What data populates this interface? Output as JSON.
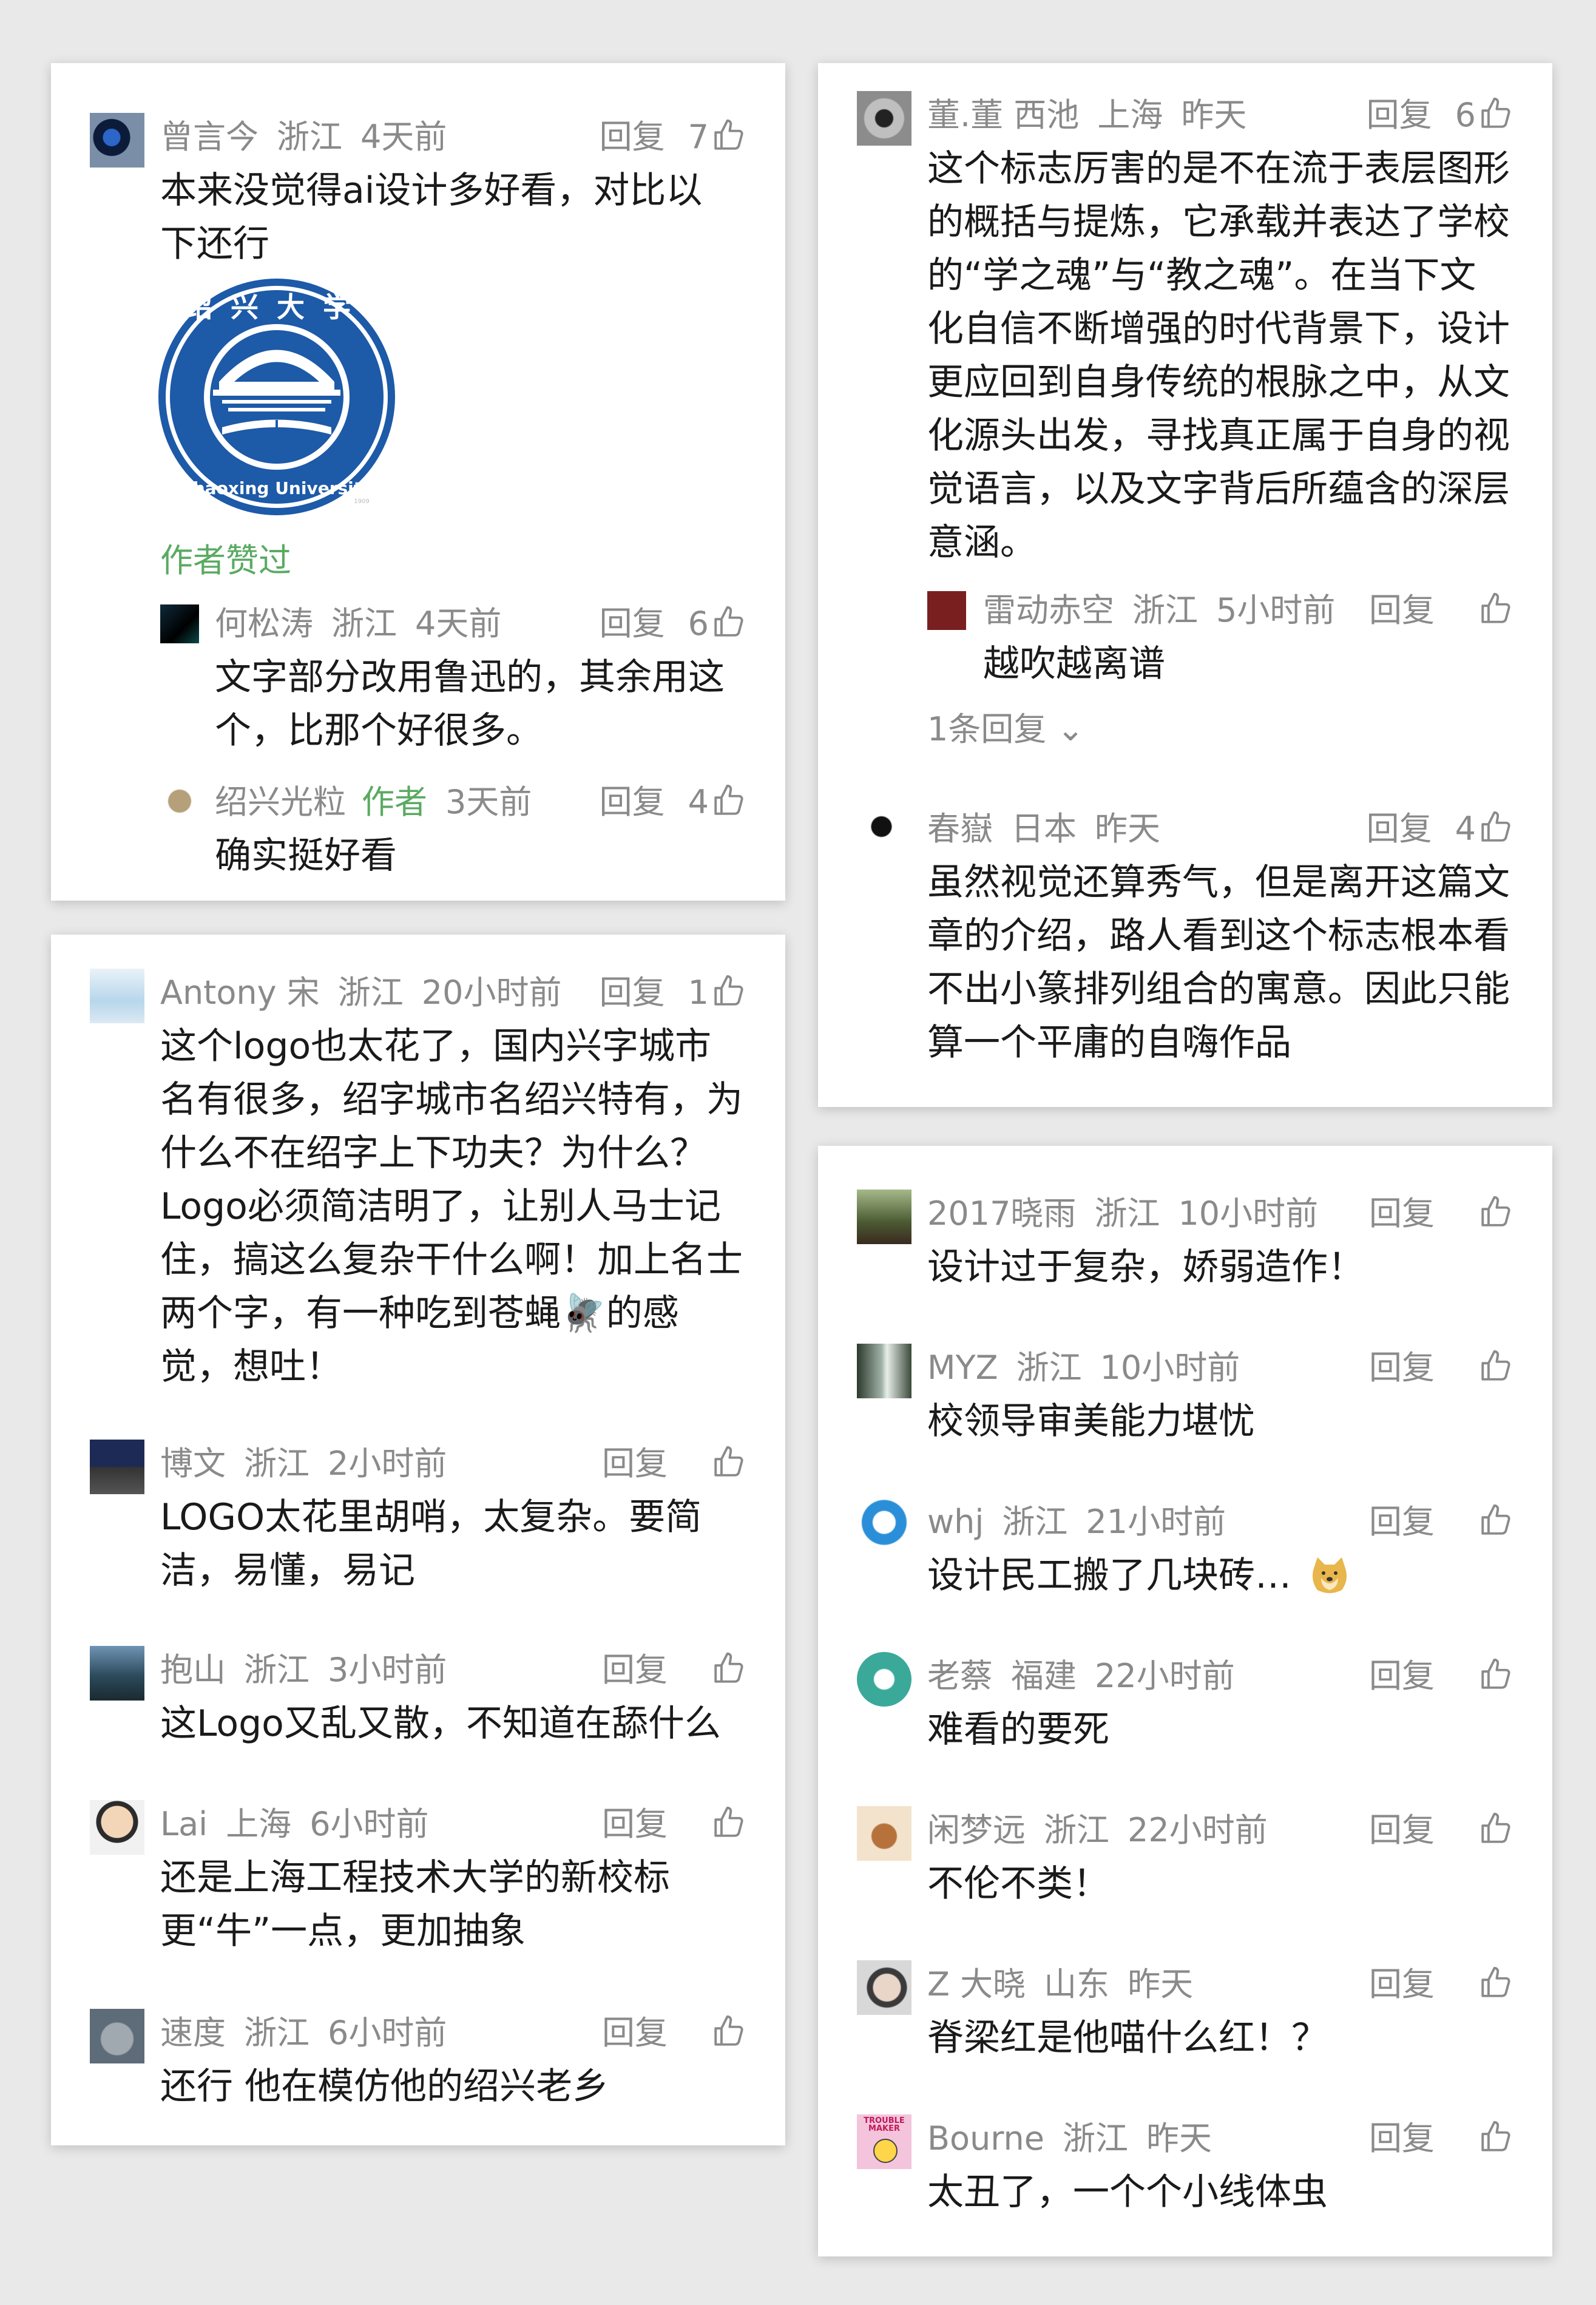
{
  "c1": {
    "main": {
      "name": "曾言今",
      "loc": "浙江",
      "time": "4天前",
      "reply": "回复",
      "likes": "7",
      "text": "本来没觉得ai设计多好看，对比以下还行"
    },
    "logo": {
      "top_text": "绍兴大学",
      "bottom_text": "Shaoxing University",
      "mark": "1909"
    },
    "liked": "作者赞过",
    "r1": {
      "name": "何松涛",
      "loc": "浙江",
      "time": "4天前",
      "reply": "回复",
      "likes": "6",
      "text": "文字部分改用鲁迅的，其余用这个，比那个好很多。"
    },
    "r2": {
      "name": "绍兴光粒",
      "author": "作者",
      "time": "3天前",
      "reply": "回复",
      "likes": "4",
      "text": "确实挺好看"
    }
  },
  "c2": {
    "a": {
      "name": "Antony 宋",
      "loc": "浙江",
      "time": "20小时前",
      "reply": "回复",
      "likes": "1",
      "text": "这个logo也太花了，国内兴字城市名有很多，绍字城市名绍兴特有，为什么不在绍字上下功夫？为什么？Logo必须简洁明了，让别人马士记住，搞这么复杂干什么啊！加上名士两个字，有一种吃到苍蝇🪰的感觉，想吐！"
    },
    "b": {
      "name": "博文",
      "loc": "浙江",
      "time": "2小时前",
      "reply": "回复",
      "likes": "",
      "text": "LOGO太花里胡哨，太复杂。要简洁，易懂，易记"
    },
    "c": {
      "name": "抱山",
      "loc": "浙江",
      "time": "3小时前",
      "reply": "回复",
      "likes": "",
      "text": "这Logo又乱又散，不知道在舔什么"
    },
    "d": {
      "name": "Lai",
      "loc": "上海",
      "time": "6小时前",
      "reply": "回复",
      "likes": "",
      "text": "还是上海工程技术大学的新校标更“牛”一点，更加抽象"
    },
    "e": {
      "name": "速度",
      "loc": "浙江",
      "time": "6小时前",
      "reply": "回复",
      "likes": "",
      "text": "还行 他在模仿他的绍兴老乡"
    }
  },
  "c3": {
    "a": {
      "name": "董.董 西池",
      "loc": "上海",
      "time": "昨天",
      "reply": "回复",
      "likes": "6",
      "text": "这个标志厉害的是不在流于表层图形的概括与提炼，它承载并表达了学校的“学之魂”与“教之魂”。在当下文化自信不断增强的时代背景下，设计更应回到自身传统的根脉之中，从文化源头出发，寻找真正属于自身的视觉语言，以及文字背后所蕴含的深层意涵。"
    },
    "r": {
      "name": "雷动赤空",
      "loc": "浙江",
      "time": "5小时前",
      "reply": "回复",
      "likes": "",
      "text": "越吹越离谱"
    },
    "more": "1条回复 ⌄",
    "b": {
      "name": "春嶽",
      "loc": "日本",
      "time": "昨天",
      "reply": "回复",
      "likes": "4",
      "text": "虽然视觉还算秀气，但是离开这篇文章的介绍，路人看到这个标志根本看不出小篆排列组合的寓意。因此只能算一个平庸的自嗨作品"
    }
  },
  "c4": {
    "a": {
      "name": "2017晓雨",
      "loc": "浙江",
      "time": "10小时前",
      "reply": "回复",
      "likes": "",
      "text": "设计过于复杂，娇弱造作！"
    },
    "b": {
      "name": "MYZ",
      "loc": "浙江",
      "time": "10小时前",
      "reply": "回复",
      "likes": "",
      "text": "校领导审美能力堪忧"
    },
    "c": {
      "name": "whj",
      "loc": "浙江",
      "time": "21小时前",
      "reply": "回复",
      "likes": "",
      "text": "设计民工搬了几块砖…"
    },
    "d": {
      "name": "老蔡",
      "loc": "福建",
      "time": "22小时前",
      "reply": "回复",
      "likes": "",
      "text": "难看的要死"
    },
    "e": {
      "name": "闲梦远",
      "loc": "浙江",
      "time": "22小时前",
      "reply": "回复",
      "likes": "",
      "text": "不伦不类！"
    },
    "f": {
      "name": "Z 大晓",
      "loc": "山东",
      "time": "昨天",
      "reply": "回复",
      "likes": "",
      "text": "脊梁红是他喵什么红！？"
    },
    "g": {
      "name": "Bourne",
      "loc": "浙江",
      "time": "昨天",
      "reply": "回复",
      "likes": "",
      "text": "太丑了，一个个小线体虫"
    }
  },
  "avatar_g_text": "TROUBLE MAKER",
  "colors": {
    "meta": "#8a8a8a",
    "accent": "#5aaa62",
    "logo_blue": "#1d5aa8"
  }
}
